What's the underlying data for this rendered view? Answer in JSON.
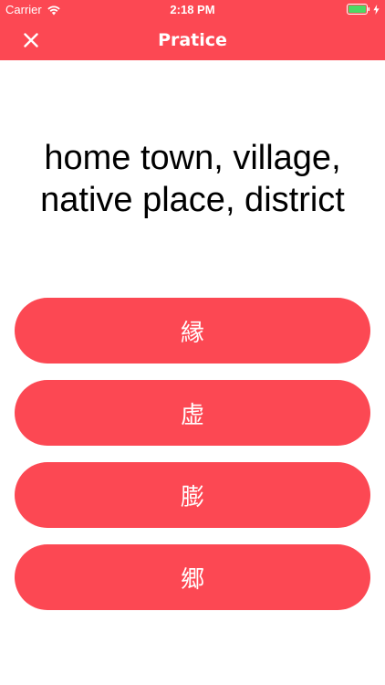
{
  "status_bar": {
    "carrier": "Carrier",
    "time": "2:18 PM",
    "wifi_icon": "wifi-icon",
    "battery_icon": "battery-icon",
    "charging_icon": "charging-bolt-icon"
  },
  "nav": {
    "title": "Pratice",
    "close_icon": "close-icon"
  },
  "question": {
    "prompt": "home town, village, native place, district"
  },
  "answers": [
    {
      "label": "縁"
    },
    {
      "label": "虚"
    },
    {
      "label": "膨"
    },
    {
      "label": "郷"
    }
  ],
  "colors": {
    "accent": "#fc4853",
    "battery_fill": "#4cd964",
    "text": "#000000",
    "background": "#ffffff"
  }
}
